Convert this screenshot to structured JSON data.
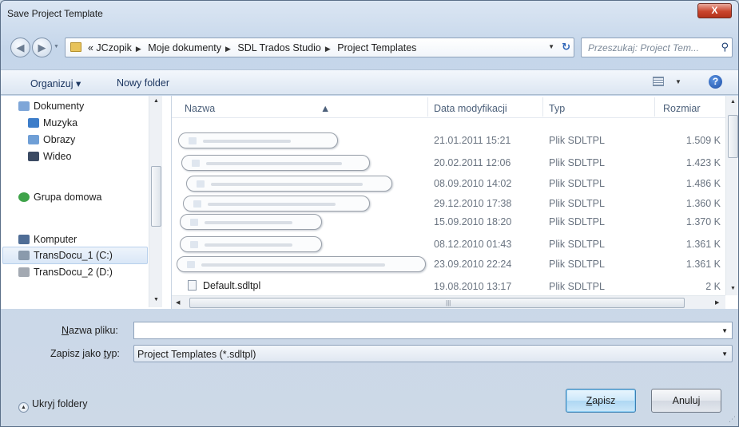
{
  "window": {
    "title": "Save Project Template",
    "close_label": "X"
  },
  "nav": {
    "back_glyph": "◀",
    "forward_glyph": "▶",
    "breadcrumbs": [
      "« JCzopik",
      "Moje dokumenty",
      "SDL Trados Studio",
      "Project Templates"
    ],
    "search_placeholder": "Przeszukaj: Project Tem..."
  },
  "toolbar": {
    "organize": "Organizuj ▾",
    "new_folder": "Nowy folder",
    "help": "?"
  },
  "navpane": {
    "items": [
      {
        "label": "Dokumenty",
        "icon": "documents-icon"
      },
      {
        "label": "Muzyka",
        "icon": "music-icon"
      },
      {
        "label": "Obrazy",
        "icon": "pictures-icon"
      },
      {
        "label": "Wideo",
        "icon": "video-icon"
      },
      {
        "label": "Grupa domowa",
        "icon": "homegroup-icon"
      },
      {
        "label": "Komputer",
        "icon": "computer-icon"
      },
      {
        "label": "TransDocu_1 (C:)",
        "icon": "drive-icon",
        "selected": true
      },
      {
        "label": "TransDocu_2 (D:)",
        "icon": "drive-icon"
      }
    ]
  },
  "filelist": {
    "columns": [
      "Nazwa",
      "Data modyfikacji",
      "Typ",
      "Rozmiar"
    ],
    "rows": [
      {
        "name_redacted": true,
        "date": "21.01.2011 15:21",
        "type": "Plik SDLTPL",
        "size": "1.509 K"
      },
      {
        "name_redacted": true,
        "date": "20.02.2011 12:06",
        "type": "Plik SDLTPL",
        "size": "1.423 K"
      },
      {
        "name_redacted": true,
        "date": "08.09.2010 14:02",
        "type": "Plik SDLTPL",
        "size": "1.486 K"
      },
      {
        "name_redacted": true,
        "date": "29.12.2010 17:38",
        "type": "Plik SDLTPL",
        "size": "1.360 K"
      },
      {
        "name_redacted": true,
        "date": "15.09.2010 18:20",
        "type": "Plik SDLTPL",
        "size": "1.370 K"
      },
      {
        "name_redacted": true,
        "date": "08.12.2010 01:43",
        "type": "Plik SDLTPL",
        "size": "1.361 K"
      },
      {
        "name_redacted": true,
        "date": "23.09.2010 22:24",
        "type": "Plik SDLTPL",
        "size": "1.361 K"
      },
      {
        "name": "Default.sdltpl",
        "date": "19.08.2010 13:17",
        "type": "Plik SDLTPL",
        "size": "2 K"
      }
    ]
  },
  "form": {
    "filename_label_prefix": "N",
    "filename_label_rest": "azwa pliku:",
    "filename_value": "",
    "savetype_label_prefix": "Zapisz jako ",
    "savetype_label_ul": "t",
    "savetype_label_rest": "yp:",
    "savetype_value": "Project Templates (*.sdltpl)"
  },
  "footer": {
    "hide_folders": "Ukryj foldery",
    "save_ul": "Z",
    "save_rest": "apisz",
    "cancel": "Anuluj"
  },
  "colors": {
    "accent": "#3c7fb1",
    "close": "#c9442c",
    "folder": "#e8c35b"
  }
}
